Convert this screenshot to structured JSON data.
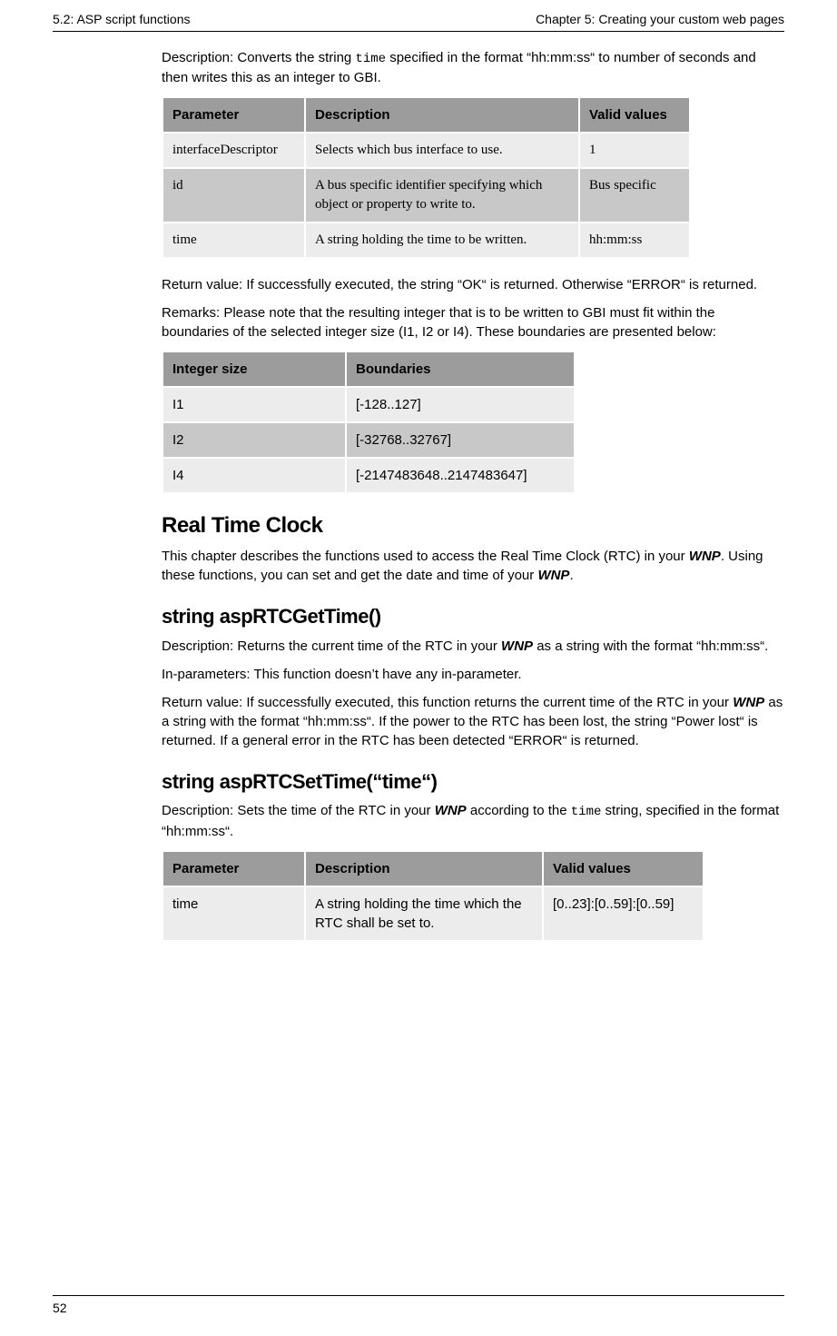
{
  "header": {
    "left": "5.2: ASP script functions",
    "right": "Chapter 5: Creating your custom web pages"
  },
  "intro": {
    "desc_prefix": "Description: Converts the string ",
    "desc_code": "time",
    "desc_suffix": " specified in the format “hh:mm:ss“ to num­ber of seconds and then writes this as an integer to GBI."
  },
  "table1": {
    "headers": {
      "c1": "Parameter",
      "c2": "Description",
      "c3": "Valid val­ues"
    },
    "rows": [
      {
        "c1": "interfaceDescriptor",
        "c2": "Selects which bus interface to use.",
        "c3": "1"
      },
      {
        "c1": "id",
        "c2": "A bus specific identifier specifying which object or property to write to.",
        "c3": "Bus specific"
      },
      {
        "c1": "time",
        "c2": "A string holding the time to be written.",
        "c3": "hh:mm:ss"
      }
    ]
  },
  "return1": "Return value: If successfully executed, the string “OK“ is returned. Otherwise “ER­ROR“ is returned.",
  "remarks": "Remarks: Please note that the resulting integer that is to be written to GBI must fit within the boundaries of the selected integer size (I1, I2 or I4). These boundaries are presented below:",
  "table2": {
    "headers": {
      "c1": "Integer size",
      "c2": "Boundaries"
    },
    "rows": [
      {
        "c1": "I1",
        "c2": "[-128..127]"
      },
      {
        "c1": "I2",
        "c2": "[-32768..32767]"
      },
      {
        "c1": "I4",
        "c2": "[-2147483648..2147483647]"
      }
    ]
  },
  "rtc": {
    "heading": "Real Time Clock",
    "para_a": "This chapter describes the functions used to access the Real Time Clock (RTC) in your ",
    "para_wnp": "WNP",
    "para_b": ". Using these functions, you can set and get the date and time of your ",
    "para_c": "."
  },
  "get": {
    "heading": "string aspRTCGetTime()",
    "desc_a": "Description: Returns the current time of the RTC in your ",
    "desc_b": " as a string with the format “hh:mm:ss“.",
    "inparam": "In-parameters: This function doesn’t have any in-parameter.",
    "ret_a": "Return value: If successfully executed, this function returns the current time of the RTC in your ",
    "ret_b": " as a string with the format “hh:mm:ss“. If the power to the RTC has been lost, the string “Power lost“ is returned. If a general error in the RTC has been detected “ERROR“ is returned."
  },
  "set": {
    "heading": "string aspRTCSetTime(“time“)",
    "desc_a": "Description: Sets the time of the RTC in your ",
    "desc_b": " according to the ",
    "desc_code": "time",
    "desc_c": " string, specified in the format “hh:mm:ss“."
  },
  "table3": {
    "headers": {
      "c1": "Parameter",
      "c2": "Description",
      "c3": "Valid values"
    },
    "rows": [
      {
        "c1": "time",
        "c2": "A string holding the time which the RTC shall be set to.",
        "c3": "[0..23]:[0..59]:[0..59]"
      }
    ]
  },
  "footer": {
    "page": "52"
  }
}
